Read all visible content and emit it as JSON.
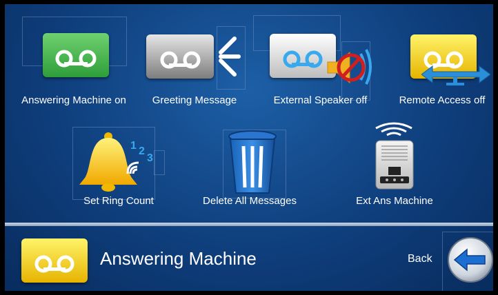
{
  "menu": {
    "items": [
      {
        "label": "Answering Machine on",
        "icon": "cassette-tape-icon"
      },
      {
        "label": "Greeting Message",
        "icon": "cassette-tape-icon"
      },
      {
        "label": "External Speaker off",
        "icon": "cassette-tape-icon"
      },
      {
        "label": "Remote Access off",
        "icon": "cassette-tape-icon"
      },
      {
        "label": "Set Ring Count",
        "icon": "bell-icon"
      },
      {
        "label": "Delete All Messages",
        "icon": "trash-can-icon"
      },
      {
        "label": "Ext Ans Machine",
        "icon": "answering-machine-device-icon"
      }
    ]
  },
  "footer": {
    "title": "Answering Machine",
    "back_label": "Back",
    "title_icon": "cassette-tape-icon",
    "back_icon": "arrow-left-icon"
  },
  "colors": {
    "background": "#0f3f7d",
    "tile_green": "#3cb54a",
    "tile_gray": "#b9b9b9",
    "tile_white": "#e8e8e8",
    "tile_yellow": "#f5d21a",
    "tape_blue": "#38a9ee"
  }
}
